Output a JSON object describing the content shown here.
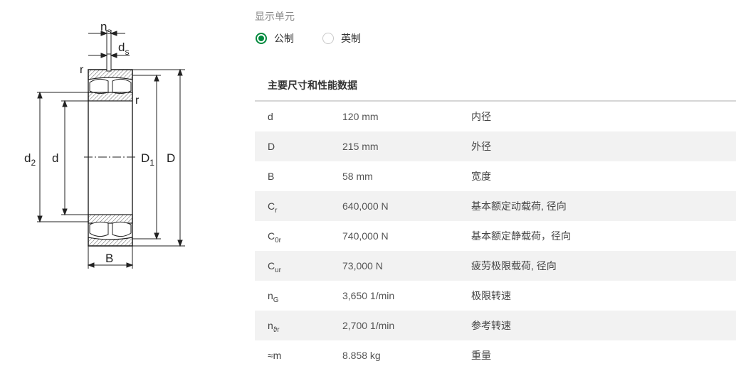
{
  "drawing": {
    "labels": {
      "ns": "n",
      "ns_sub": "s",
      "ds": "d",
      "ds_sub": "s",
      "r_top": "r",
      "r_inner": "r",
      "d2": "d",
      "d2_sub": "2",
      "d": "d",
      "D1": "D",
      "D1_sub": "1",
      "D": "D",
      "B": "B"
    }
  },
  "units": {
    "title": "显示单元",
    "metric": "公制",
    "imperial": "英制",
    "selected": "metric"
  },
  "table": {
    "title": "主要尺寸和性能数据",
    "rows": [
      {
        "sym": "d",
        "sub": "",
        "value": "120 mm",
        "desc": "内径"
      },
      {
        "sym": "D",
        "sub": "",
        "value": "215 mm",
        "desc": "外径"
      },
      {
        "sym": "B",
        "sub": "",
        "value": "58 mm",
        "desc": "宽度"
      },
      {
        "sym": "C",
        "sub": "r",
        "value": "640,000 N",
        "desc": "基本额定动载荷, 径向"
      },
      {
        "sym": "C",
        "sub": "0r",
        "value": "740,000 N",
        "desc": "基本额定静载荷，径向"
      },
      {
        "sym": "C",
        "sub": "ur",
        "value": "73,000 N",
        "desc": "疲劳极限载荷, 径向"
      },
      {
        "sym": "n",
        "sub": "G",
        "value": "3,650 1/min",
        "desc": "极限转速"
      },
      {
        "sym": "n",
        "sub": "ϑr",
        "value": "2,700 1/min",
        "desc": "参考转速"
      },
      {
        "sym": "≈m",
        "sub": "",
        "value": "8.858 kg",
        "desc": "重量"
      }
    ]
  }
}
